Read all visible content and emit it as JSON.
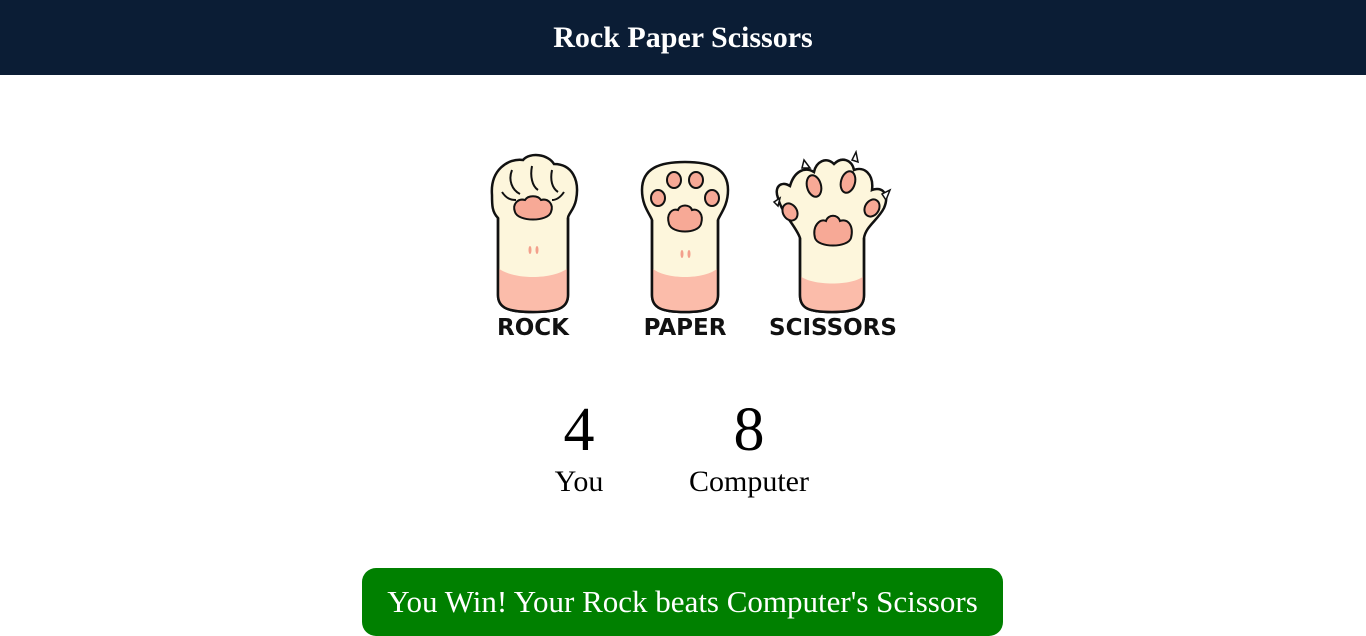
{
  "header": {
    "title": "Rock Paper Scissors"
  },
  "choices": [
    {
      "id": "rock",
      "label": "ROCK"
    },
    {
      "id": "paper",
      "label": "PAPER"
    },
    {
      "id": "scissors",
      "label": "SCISSORS"
    }
  ],
  "score": {
    "user": {
      "value": "4",
      "label": "You"
    },
    "computer": {
      "value": "8",
      "label": "Computer"
    }
  },
  "result": {
    "message": "You Win! Your Rock beats Computer's Scissors"
  },
  "colors": {
    "header_bg": "#0b1d35",
    "result_bg": "#008000",
    "paw_fill": "#fdf6dc",
    "paw_pink": "#fbbcaa",
    "pad_pink": "#f7a996"
  }
}
